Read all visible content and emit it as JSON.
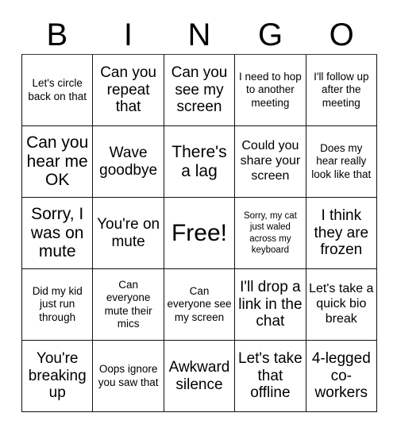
{
  "card": {
    "title": "BINGO",
    "header_letters": [
      "B",
      "I",
      "N",
      "G",
      "O"
    ],
    "free_space_label": "Free!",
    "cells": [
      {
        "text": "Let's circle back on that",
        "size": "sm"
      },
      {
        "text": "Can you repeat that",
        "size": "lg"
      },
      {
        "text": "Can you see my screen",
        "size": "lg"
      },
      {
        "text": "I need to hop to another meeting",
        "size": "sm"
      },
      {
        "text": "I'll follow up after the meeting",
        "size": "sm"
      },
      {
        "text": "Can you hear me OK",
        "size": "xl"
      },
      {
        "text": "Wave goodbye",
        "size": "lg"
      },
      {
        "text": "There's a lag",
        "size": "xl"
      },
      {
        "text": "Could you share your screen",
        "size": "md"
      },
      {
        "text": "Does my hear really look like that",
        "size": "sm"
      },
      {
        "text": "Sorry, I was on mute",
        "size": "xl"
      },
      {
        "text": "You're on mute",
        "size": "lg"
      },
      {
        "text": "Free!",
        "size": "free"
      },
      {
        "text": "Sorry, my cat just waled across my keyboard",
        "size": "xs"
      },
      {
        "text": "I think they are frozen",
        "size": "lg"
      },
      {
        "text": "Did my kid just run through",
        "size": "sm"
      },
      {
        "text": "Can everyone mute their mics",
        "size": "sm"
      },
      {
        "text": "Can everyone see my screen",
        "size": "sm"
      },
      {
        "text": "I'll drop a link in the chat",
        "size": "lg"
      },
      {
        "text": "Let's take a quick bio break",
        "size": "md"
      },
      {
        "text": "You're breaking up",
        "size": "lg"
      },
      {
        "text": "Oops ignore you saw that",
        "size": "sm"
      },
      {
        "text": "Awkward silence",
        "size": "lg"
      },
      {
        "text": "Let's take that offline",
        "size": "lg"
      },
      {
        "text": "4-legged co-workers",
        "size": "lg"
      }
    ]
  },
  "colors": {
    "background": "#ffffff",
    "border": "#111111",
    "text": "#000000"
  }
}
